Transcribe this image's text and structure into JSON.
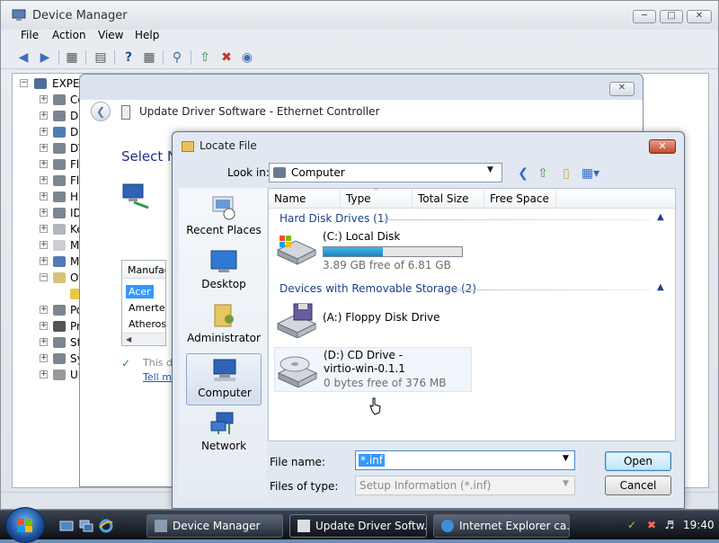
{
  "device_manager": {
    "title": "Device Manager",
    "menu": [
      "File",
      "Action",
      "View",
      "Help"
    ],
    "tree_root": "EXPER",
    "tree_items": [
      "Co",
      "Di",
      "Di",
      "DV",
      "Fl",
      "Fl",
      "Hu",
      "ID",
      "Ke",
      "M",
      "M",
      "Ot",
      "",
      "Po",
      "Pr",
      "St",
      "Sy",
      "Ur"
    ]
  },
  "wizard": {
    "title": "Update Driver Software - Ethernet Controller",
    "heading": "Select N",
    "list_header": "Manufac",
    "list_items": [
      "Acer",
      "Amertek",
      "Atheros C"
    ],
    "signed_text": "This d",
    "tell_me_link": "Tell m"
  },
  "locate_file": {
    "title": "Locate File",
    "look_in_label": "Look in:",
    "look_in_value": "Computer",
    "places": [
      "Recent Places",
      "Desktop",
      "Administrator",
      "Computer",
      "Network"
    ],
    "active_place": "Computer",
    "columns": [
      "Name",
      "Type",
      "Total Size",
      "Free Space"
    ],
    "groups": [
      {
        "name": "Hard Disk Drives (1)",
        "drives": [
          {
            "name": "(C:) Local Disk",
            "free_text": "3.89 GB free of 6.81 GB",
            "used_fraction": 0.43
          }
        ]
      },
      {
        "name": "Devices with Removable Storage (2)",
        "drives": [
          {
            "name": "(A:) Floppy Disk Drive"
          },
          {
            "name_line1": "(D:) CD Drive -",
            "name_line2": "virtio-win-0.1.1",
            "free_text": "0 bytes free of 376 MB"
          }
        ]
      }
    ],
    "file_name_label": "File name:",
    "file_name_value": "*.inf",
    "files_of_type_label": "Files of type:",
    "files_of_type_value": "Setup Information (*.inf)",
    "open_button": "Open",
    "cancel_button": "Cancel"
  },
  "taskbar": {
    "tasks": [
      "Device Manager",
      "Update Driver Softw...",
      "Internet Explorer ca..."
    ],
    "active_task": "Update Driver Softw...",
    "clock": "19:40"
  }
}
